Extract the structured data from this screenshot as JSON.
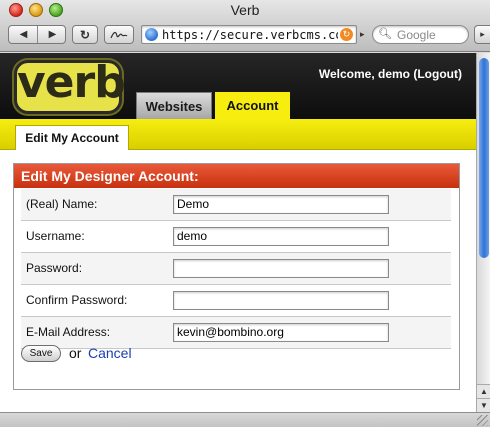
{
  "window": {
    "title": "Verb"
  },
  "toolbar": {
    "back_icon": "◀",
    "forward_icon": "▶",
    "reload_icon": "↻",
    "url": "https://secure.verbcms.com/d",
    "search_placeholder": "Google"
  },
  "site": {
    "logo_text": "verb",
    "welcome": "Welcome, demo",
    "logout": "(Logout)",
    "tabs": [
      {
        "label": "Websites",
        "active": false
      },
      {
        "label": "Account",
        "active": true
      }
    ],
    "subtab": "Edit My Account"
  },
  "form": {
    "heading": "Edit My Designer Account:",
    "fields": [
      {
        "label": "(Real) Name:",
        "value": "Demo"
      },
      {
        "label": "Username:",
        "value": "demo"
      },
      {
        "label": "Password:",
        "value": ""
      },
      {
        "label": "Confirm Password:",
        "value": ""
      },
      {
        "label": "E-Mail Address:",
        "value": "kevin@bombino.org"
      }
    ],
    "save_label": "Save",
    "or_text": "or",
    "cancel_label": "Cancel"
  },
  "colors": {
    "accent_yellow": "#f7ee10",
    "header_red": "#d63d1b",
    "link_blue": "#1b3fb3"
  }
}
